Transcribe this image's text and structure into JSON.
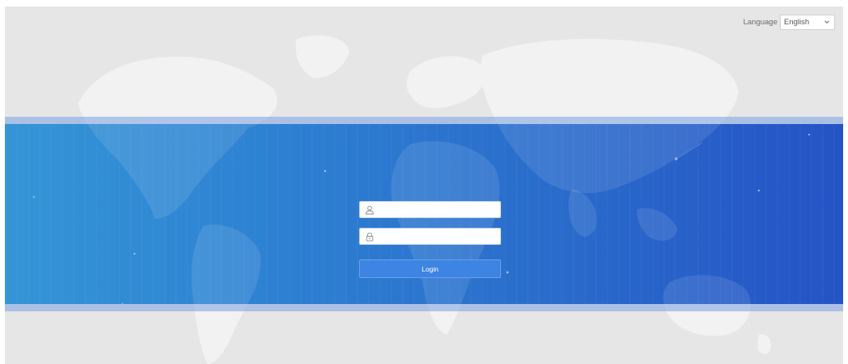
{
  "header": {
    "language_label": "Language",
    "language_selected": "English"
  },
  "login": {
    "username_placeholder": "",
    "password_placeholder": "",
    "button_label": "Login"
  },
  "icons": {
    "username": "user-icon",
    "password": "lock-icon",
    "dropdown": "chevron-down-icon",
    "background": "world-map"
  },
  "colors": {
    "page_background": "#e6e6e6",
    "band_start": "#3595d6",
    "band_end": "#2553c6",
    "button": "#3d84e3"
  }
}
